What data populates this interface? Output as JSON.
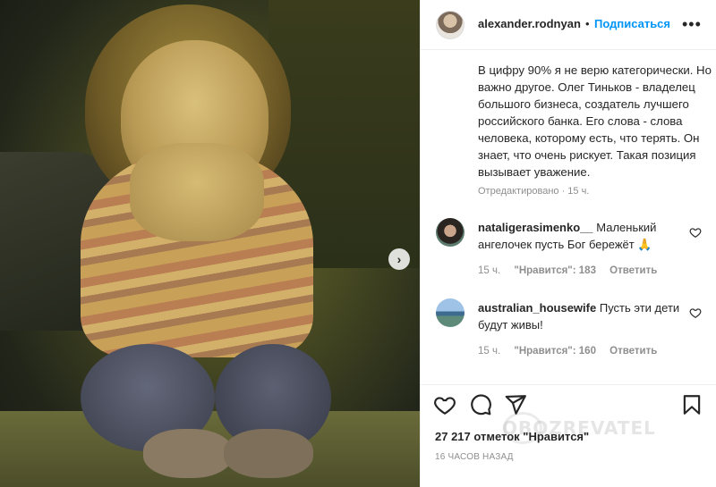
{
  "post": {
    "username": "alexander.rodnyan",
    "separator": "•",
    "follow_label": "Подписаться",
    "more_icon": "more-horizontal-icon",
    "caption": "В цифру 90% я не верю категорически. Но важно другое. Олег Тиньков - владелец большого бизнеса, создатель лучшего российского банка. Его слова - слова человека, которому есть, что терять. Он знает, что очень рискует. Такая позиция вызывает уважение.",
    "edited": "Отредактировано · 15 ч."
  },
  "media": {
    "next_icon": "›"
  },
  "comments": [
    {
      "username": "nataligerasimenko__",
      "text": "Маленький ангелочек пусть Бог бережёт 🙏",
      "time": "15 ч.",
      "likes": "\"Нравится\": 183",
      "reply": "Ответить"
    },
    {
      "username": "australian_housewife",
      "text": "Пусть эти дети будут живы!",
      "time": "15 ч.",
      "likes": "\"Нравится\": 160",
      "reply": "Ответить"
    }
  ],
  "actions": {
    "likes_count": "27 217 отметок \"Нравится\"",
    "time_ago": "16 ЧАСОВ НАЗАД"
  },
  "watermark": "OBOZREVATEL"
}
